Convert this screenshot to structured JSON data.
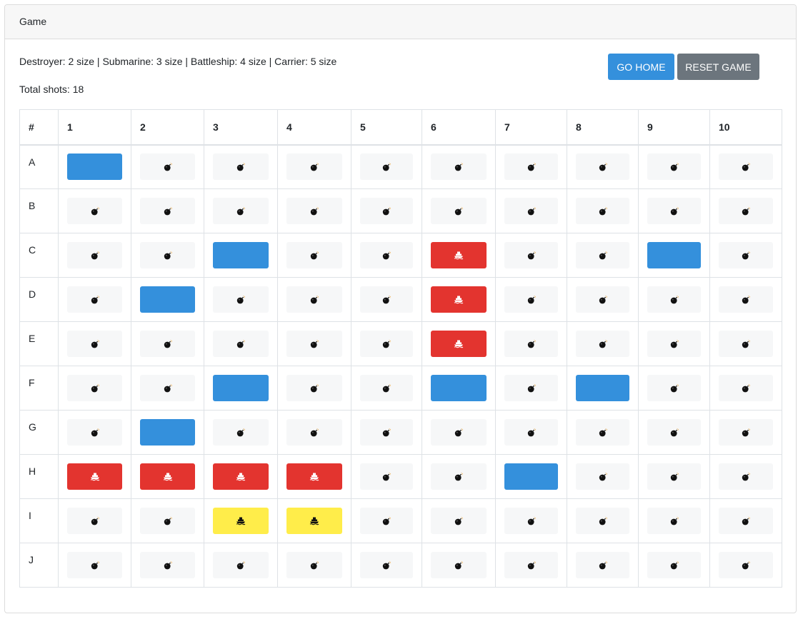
{
  "header": {
    "title": "Game"
  },
  "info": {
    "ships_text": "Destroyer: 2 size | Submarine: 3 size | Battleship: 4 size | Carrier: 5 size",
    "total_shots": "Total shots: 18"
  },
  "buttons": {
    "home": "GO HOME",
    "reset": "RESET GAME"
  },
  "colors": {
    "miss": "#3490dc",
    "hit": "#e3342f",
    "sunk": "#ffed4a",
    "untested": "#f6f7f8",
    "reset": "#6c757d"
  },
  "board": {
    "corner": "#",
    "columns": [
      "1",
      "2",
      "3",
      "4",
      "5",
      "6",
      "7",
      "8",
      "9",
      "10"
    ],
    "rows": [
      {
        "label": "A",
        "cells": [
          "miss",
          "bomb",
          "bomb",
          "bomb",
          "bomb",
          "bomb",
          "bomb",
          "bomb",
          "bomb",
          "bomb"
        ]
      },
      {
        "label": "B",
        "cells": [
          "bomb",
          "bomb",
          "bomb",
          "bomb",
          "bomb",
          "bomb",
          "bomb",
          "bomb",
          "bomb",
          "bomb"
        ]
      },
      {
        "label": "C",
        "cells": [
          "bomb",
          "bomb",
          "miss",
          "bomb",
          "bomb",
          "hit",
          "bomb",
          "bomb",
          "miss",
          "bomb"
        ]
      },
      {
        "label": "D",
        "cells": [
          "bomb",
          "miss",
          "bomb",
          "bomb",
          "bomb",
          "hit",
          "bomb",
          "bomb",
          "bomb",
          "bomb"
        ]
      },
      {
        "label": "E",
        "cells": [
          "bomb",
          "bomb",
          "bomb",
          "bomb",
          "bomb",
          "hit",
          "bomb",
          "bomb",
          "bomb",
          "bomb"
        ]
      },
      {
        "label": "F",
        "cells": [
          "bomb",
          "bomb",
          "miss",
          "bomb",
          "bomb",
          "miss",
          "bomb",
          "miss",
          "bomb",
          "bomb"
        ]
      },
      {
        "label": "G",
        "cells": [
          "bomb",
          "miss",
          "bomb",
          "bomb",
          "bomb",
          "bomb",
          "bomb",
          "bomb",
          "bomb",
          "bomb"
        ]
      },
      {
        "label": "H",
        "cells": [
          "hit",
          "hit",
          "hit",
          "hit",
          "bomb",
          "bomb",
          "miss",
          "bomb",
          "bomb",
          "bomb"
        ]
      },
      {
        "label": "I",
        "cells": [
          "bomb",
          "bomb",
          "sunk",
          "sunk",
          "bomb",
          "bomb",
          "bomb",
          "bomb",
          "bomb",
          "bomb"
        ]
      },
      {
        "label": "J",
        "cells": [
          "bomb",
          "bomb",
          "bomb",
          "bomb",
          "bomb",
          "bomb",
          "bomb",
          "bomb",
          "bomb",
          "bomb"
        ]
      }
    ]
  }
}
